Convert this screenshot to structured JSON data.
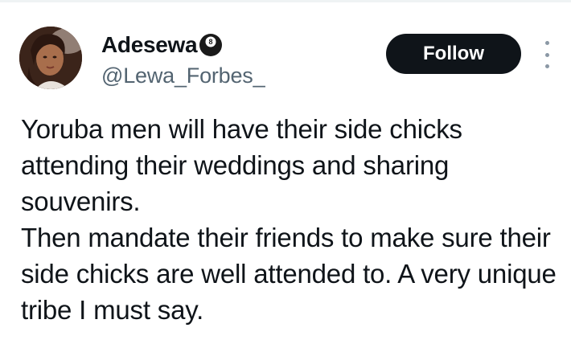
{
  "tweet": {
    "author": {
      "display_name": "Adesewa",
      "name_emoji": "pool-8-ball-icon",
      "handle": "@Lewa_Forbes_"
    },
    "follow_label": "Follow",
    "paragraphs": [
      "Yoruba men will have their side chicks attending their weddings and sharing souvenirs.",
      "Then mandate their friends to make sure their side chicks are well attended to. A very unique tribe I must say."
    ]
  },
  "colors": {
    "text": "#0f1419",
    "secondary_text": "#536471",
    "follow_bg": "#0f1419",
    "follow_text": "#ffffff"
  }
}
